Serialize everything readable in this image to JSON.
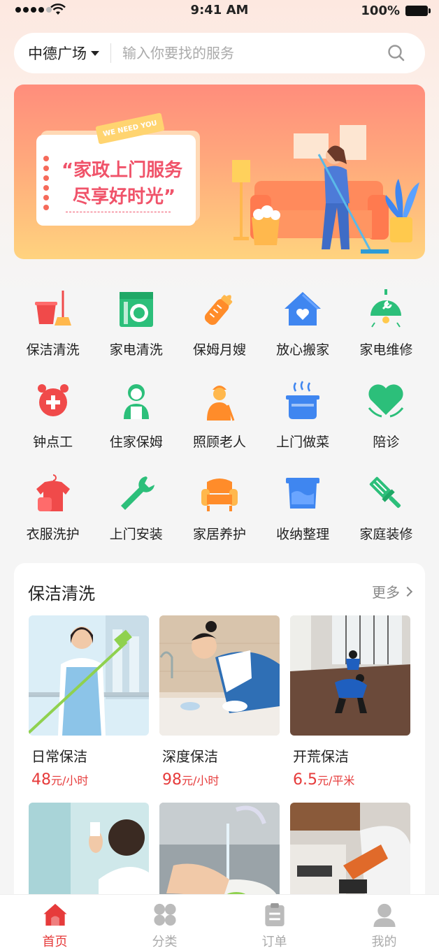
{
  "status_bar": {
    "time": "9:41 AM",
    "battery": "100%"
  },
  "search": {
    "location": "中德广场",
    "placeholder": "输入你要找的服务"
  },
  "banner": {
    "tag": "WE NEED YOU",
    "line1": "“家政上门服务",
    "line2": "尽享好时光”"
  },
  "services": [
    {
      "label": "保洁清洗",
      "icon": "bucket-mop-icon",
      "color": "#f04a4a"
    },
    {
      "label": "家电清洗",
      "icon": "washing-machine-icon",
      "color": "#2cbf7a"
    },
    {
      "label": "保姆月嫂",
      "icon": "baby-bottle-icon",
      "color": "#ff8c2a"
    },
    {
      "label": "放心搬家",
      "icon": "house-heart-icon",
      "color": "#3f86f0"
    },
    {
      "label": "家电维修",
      "icon": "lamp-wrench-icon",
      "color": "#2cbf7a"
    },
    {
      "label": "钟点工",
      "icon": "alarm-clock-icon",
      "color": "#f04a4a"
    },
    {
      "label": "住家保姆",
      "icon": "nanny-icon",
      "color": "#2cbf7a"
    },
    {
      "label": "照顾老人",
      "icon": "elderly-icon",
      "color": "#ff8c2a"
    },
    {
      "label": "上门做菜",
      "icon": "cooking-pot-icon",
      "color": "#3f86f0"
    },
    {
      "label": "陪诊",
      "icon": "heart-hands-icon",
      "color": "#2cbf7a"
    },
    {
      "label": "衣服洗护",
      "icon": "shirt-hanger-icon",
      "color": "#f04a4a"
    },
    {
      "label": "上门安装",
      "icon": "wrench-icon",
      "color": "#2cbf7a"
    },
    {
      "label": "家居养护",
      "icon": "sofa-icon",
      "color": "#ff8c2a"
    },
    {
      "label": "收纳整理",
      "icon": "storage-box-icon",
      "color": "#3f86f0"
    },
    {
      "label": "家庭装修",
      "icon": "paint-brush-icon",
      "color": "#2cbf7a"
    }
  ],
  "section": {
    "title": "保洁清洗",
    "more": "更多",
    "cards": [
      {
        "name": "日常保洁",
        "price": "48",
        "unit": "元/小时"
      },
      {
        "name": "深度保洁",
        "price": "98",
        "unit": "元/小时"
      },
      {
        "name": "开荒保洁",
        "price": "6.5",
        "unit": "元/平米"
      }
    ]
  },
  "tabs": [
    {
      "label": "首页",
      "icon": "home-icon",
      "active": true
    },
    {
      "label": "分类",
      "icon": "category-icon",
      "active": false
    },
    {
      "label": "订单",
      "icon": "order-clipboard-icon",
      "active": false
    },
    {
      "label": "我的",
      "icon": "user-icon",
      "active": false
    }
  ],
  "colors": {
    "accent": "#e63b3b",
    "green": "#2cbf7a",
    "orange": "#ff8c2a",
    "blue": "#3f86f0"
  }
}
